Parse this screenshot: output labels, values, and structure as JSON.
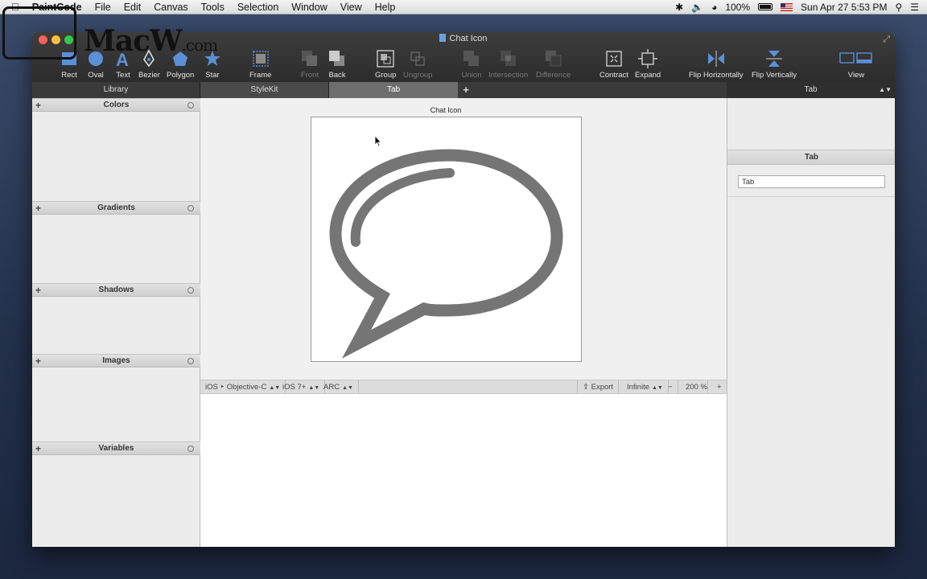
{
  "menubar": {
    "app_name": "PaintCode",
    "items": [
      "File",
      "Edit",
      "Canvas",
      "Tools",
      "Selection",
      "Window",
      "View",
      "Help"
    ],
    "battery": "100%",
    "datetime": "Sun Apr 27  5:53 PM"
  },
  "watermark": {
    "text": "MacW",
    "suffix": ".com"
  },
  "window": {
    "title": "Chat Icon"
  },
  "toolbar": {
    "rect": "Rect",
    "oval": "Oval",
    "text": "Text",
    "bezier": "Bezier",
    "polygon": "Polygon",
    "star": "Star",
    "frame": "Frame",
    "front": "Front",
    "back": "Back",
    "group": "Group",
    "ungroup": "Ungroup",
    "union": "Union",
    "intersection": "Intersection",
    "difference": "Difference",
    "contract": "Contract",
    "expand": "Expand",
    "flip_h": "Flip Horizontally",
    "flip_v": "Flip Vertically",
    "view": "View"
  },
  "tabs": {
    "library": "Library",
    "stylekit": "StyleKit",
    "tab": "Tab",
    "add": "+"
  },
  "library": {
    "sections": [
      "Colors",
      "Gradients",
      "Shadows",
      "Images",
      "Variables"
    ]
  },
  "canvas": {
    "frame_label": "Chat Icon"
  },
  "codebar": {
    "platform": "iOS ‣ Objective-C",
    "version": "iOS 7+",
    "memory": "ARC",
    "export": "Export",
    "size": "Infinite",
    "minus": "−",
    "zoom": "200 %",
    "plus": "+"
  },
  "inspector": {
    "title": "Tab",
    "section": "Tab",
    "name_value": "Tab"
  },
  "colors": {
    "toolbar_bg": "#333333",
    "shape_gray": "#757575",
    "accent": "#5b8fd6"
  }
}
